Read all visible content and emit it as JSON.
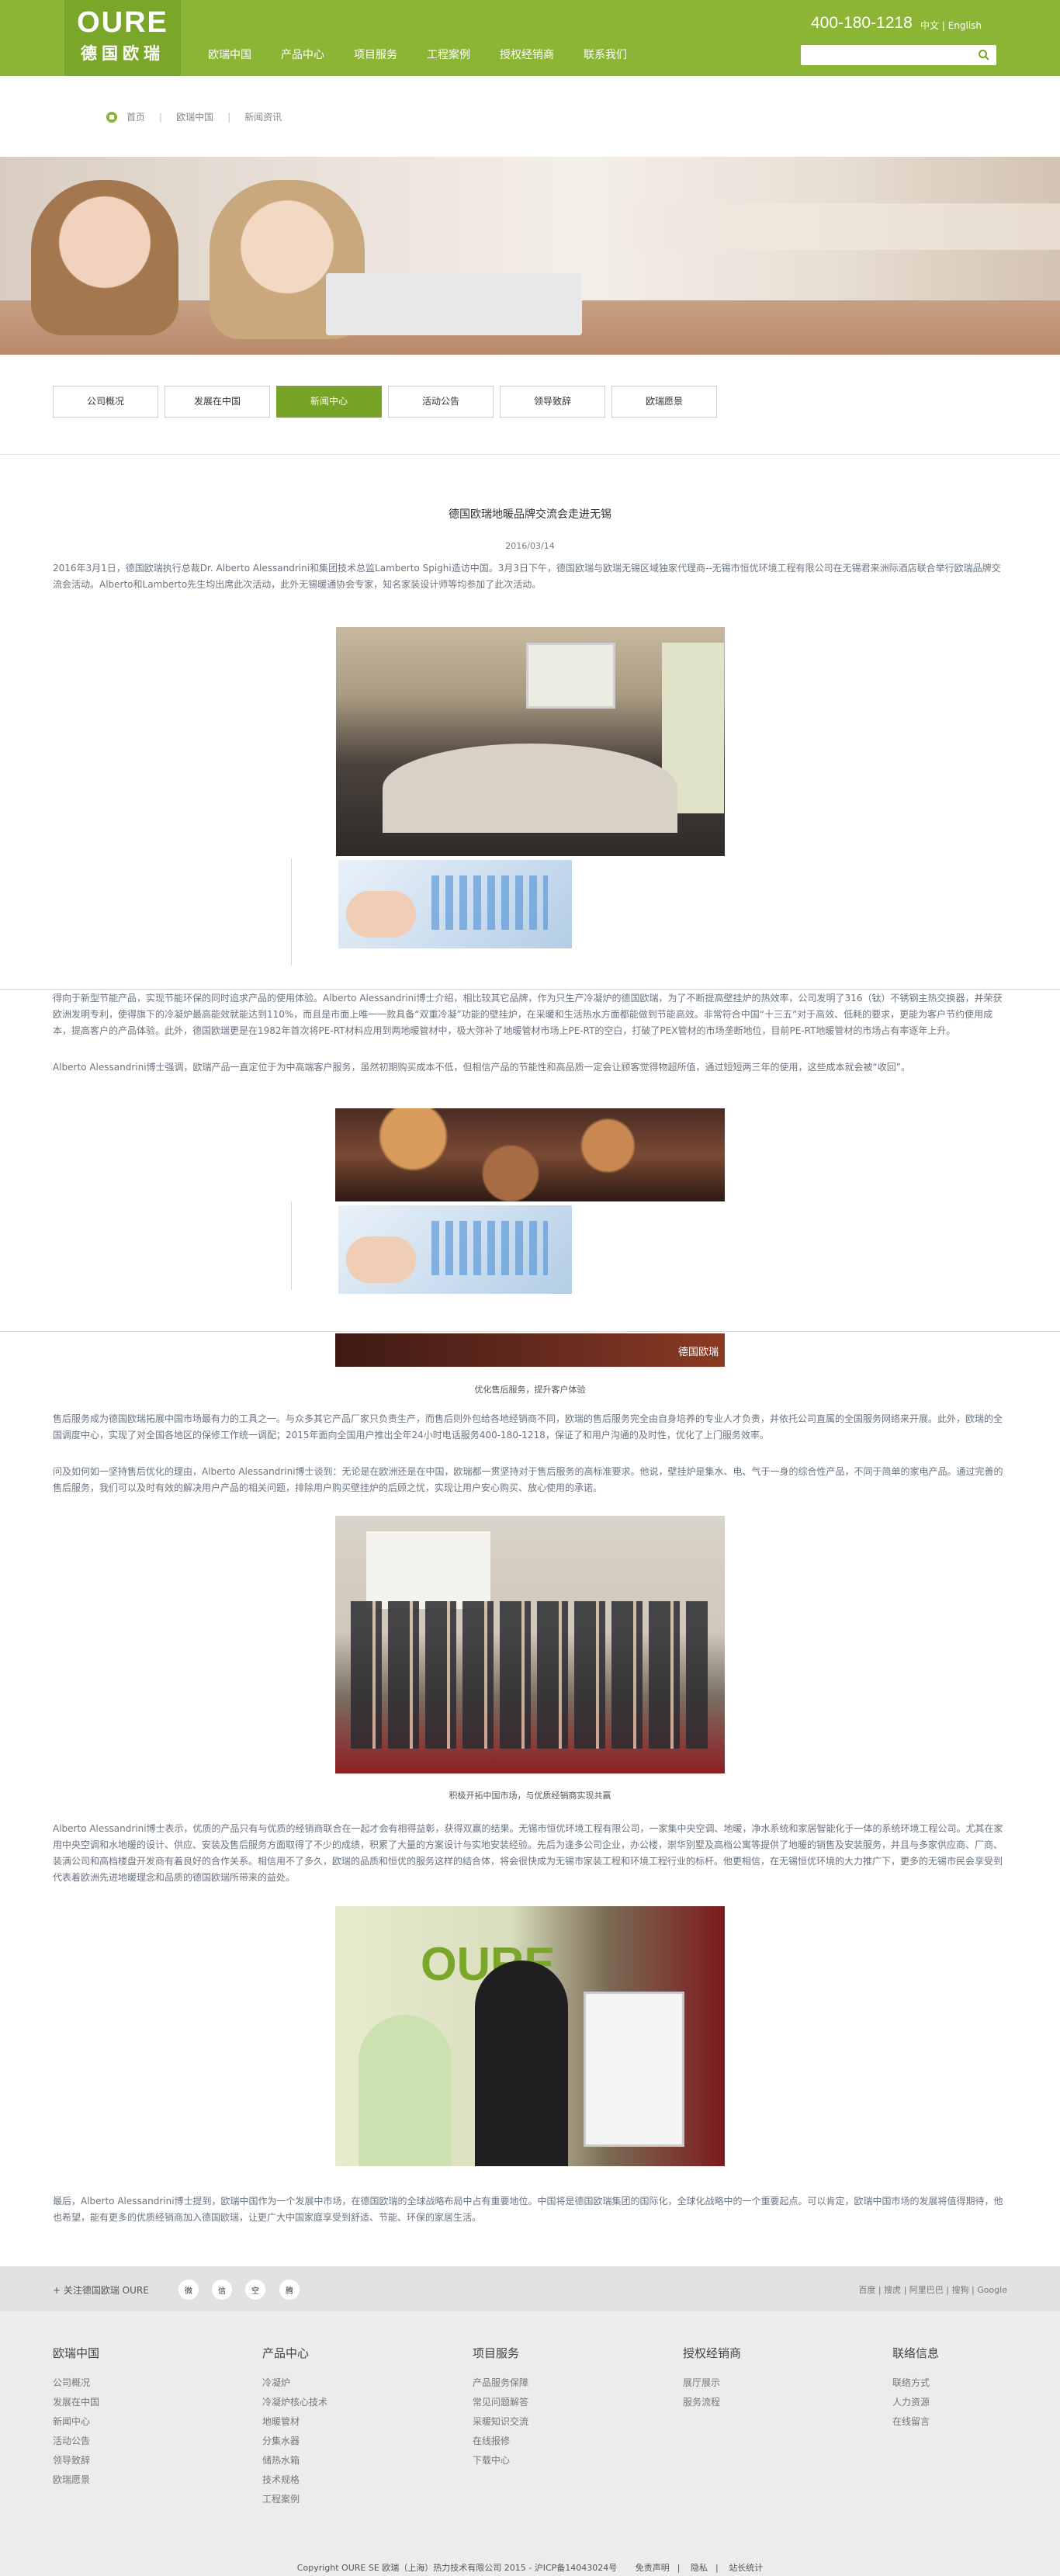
{
  "header": {
    "logo_top": "OURE",
    "logo_bottom": "德国欧瑞",
    "nav": [
      "欧瑞中国",
      "产品中心",
      "项目服务",
      "工程案例",
      "授权经销商",
      "联系我们"
    ],
    "phone": "400-180-1218",
    "lang_cn": "中文",
    "lang_sep": " | ",
    "lang_en": "English",
    "search_placeholder": ""
  },
  "breadcrumb": [
    "首页",
    "欧瑞中国",
    "新闻资讯"
  ],
  "tabs": [
    "公司概况",
    "发展在中国",
    "新闻中心",
    "活动公告",
    "领导致辞",
    "欧瑞愿景"
  ],
  "active_tab": "新闻中心",
  "article": {
    "title": "德国欧瑞地暖品牌交流会走进无锡",
    "date": "2016/03/14",
    "p1": "2016年3月1日，德国欧瑞执行总裁Dr. Alberto Alessandrini和集团技术总监Lamberto Spighi造访中国。3月3日下午，德国欧瑞与欧瑞无锡区域独家代理商--无锡市恒优环境工程有限公司在无锡君来洲际酒店联合举行欧瑞品牌交流会活动。Alberto和Lamberto先生均出席此次活动，此外无锡暖通协会专家，知名家装设计师等均参加了此次活动。",
    "p2": "得向于新型节能产品，实现节能环保的同时追求产品的使用体验。Alberto Alessandrini博士介绍，相比较其它品牌，作为只生产冷凝炉的德国欧瑞，为了不断提高壁挂炉的热效率，公司发明了316（钛）不锈钢主热交换器，并荣获欧洲发明专利，使得旗下的冷凝炉最高能效就能达到110%，而且是市面上唯一一款具备“双重冷凝”功能的壁挂炉，在采暖和生活热水方面都能做到节能高效。非常符合中国“十三五”对于高效、低耗的要求，更能为客户节约使用成本，提高客户的产品体验。此外，德国欧瑞更是在1982年首次将PE-RT材料应用到两地暖管材中，极大弥补了地暖管材市场上PE-RT的空白，打破了PEX管材的市场垄断地位，目前PE-RT地暖管材的市场占有率逐年上升。",
    "p3": "Alberto Alessandrini博士强调，欧瑞产品一直定位于为中高端客户服务，虽然初期购买成本不低，但相信产品的节能性和高品质一定会让顾客觉得物超所值，通过短短两三年的使用，这些成本就会被“收回”。",
    "caption1": "优化售后服务，提升客户体验",
    "p4": "售后服务成为德国欧瑞拓展中国市场最有力的工具之一。与众多其它产品厂家只负责生产，而售后则外包给各地经销商不同，欧瑞的售后服务完全由自身培养的专业人才负责，并依托公司直属的全国服务网络来开展。此外，欧瑞的全国调度中心，实现了对全国各地区的保修工作统一调配；2015年面向全国用户推出全年24小时电话服务400-180-1218，保证了和用户沟通的及时性，优化了上门服务效率。",
    "p5": "问及如何如一坚持售后优化的理由，Alberto Alessandrini博士谈到：无论是在欧洲还是在中国，欧瑞都一贯坚持对于售后服务的高标准要求。他说，壁挂炉是集水、电、气于一身的综合性产品，不同于简单的家电产品。通过完善的售后服务，我们可以及时有效的解决用户产品的相关问题，排除用户购买壁挂炉的后顾之忧，实现让用户安心购买、放心使用的承诺。",
    "caption2": "积极开拓中国市场，与优质经销商实现共赢",
    "p6": "Alberto Alessandrini博士表示，优质的产品只有与优质的经销商联合在一起才会有相得益彰，获得双赢的结果。无锡市恒优环境工程有限公司，一家集中央空调、地暖，净水系统和家居智能化于一体的系统环境工程公司。尤其在家用中央空调和水地暖的设计、供应、安装及售后服务方面取得了不少的成绩，积累了大量的方案设计与实地安装经验。先后为逢多公司企业，办公楼，崇华别墅及高档公寓等提供了地暖的销售及安装服务，并且与多家供应商、厂商、装满公司和高档楼盘开发商有着良好的合作关系。相信用不了多久，欧瑞的品质和恒优的服务这样的结合体，将会很快成为无锡市家装工程和环境工程行业的标杆。他更相信，在无锡恒优环境的大力推广下，更多的无锡市民会享受到代表着欧洲先进地暖理念和品质的德国欧瑞所带来的益处。",
    "p7": "最后，Alberto Alessandrini博士提到，欧瑞中国作为一个发展中市场，在德国欧瑞的全球战略布局中占有重要地位。中国将是德国欧瑞集团的国际化，全球化战略中的一个重要起点。可以肯定，欧瑞中国市场的发展将值得期待，他也希望，能有更多的优质经销商加入德国欧瑞，让更广大中国家庭享受到舒适、节能、环保的家居生活。",
    "strip_watermark": "德国欧瑞"
  },
  "share": {
    "label": "+ 关注德国欧瑞 OURE",
    "icons": [
      "weibo-icon",
      "wechat-icon",
      "qzone-icon",
      "tencent-weibo-icon"
    ],
    "icon_text": [
      "微",
      "信",
      "空",
      "腾"
    ],
    "links": [
      "百度",
      "搜虎",
      "阿里巴巴",
      "搜狗",
      "Google"
    ]
  },
  "footer": {
    "columns": [
      {
        "title": "欧瑞中国",
        "items": [
          "公司概况",
          "发展在中国",
          "新闻中心",
          "活动公告",
          "领导致辞",
          "欧瑞愿景"
        ]
      },
      {
        "title": "产品中心",
        "items": [
          "冷凝炉",
          "冷凝炉核心技术",
          "地暖管材",
          "分集水器",
          "储热水箱",
          "技术规格",
          "工程案例"
        ]
      },
      {
        "title": "项目服务",
        "items": [
          "产品服务保障",
          "常见问题解答",
          "采暖知识交流",
          "在线报修",
          "下载中心"
        ]
      },
      {
        "title": "授权经销商",
        "items": [
          "展厅展示",
          "服务流程"
        ]
      },
      {
        "title": "联络信息",
        "items": [
          "联络方式",
          "人力资源",
          "在线留言"
        ]
      }
    ],
    "copyright": "Copyright OURE SE 欧瑞（上海）热力技术有限公司 2015 - 沪ICP备14043024号",
    "bottom_links": [
      "免责声明",
      "隐私",
      "站长统计"
    ]
  }
}
